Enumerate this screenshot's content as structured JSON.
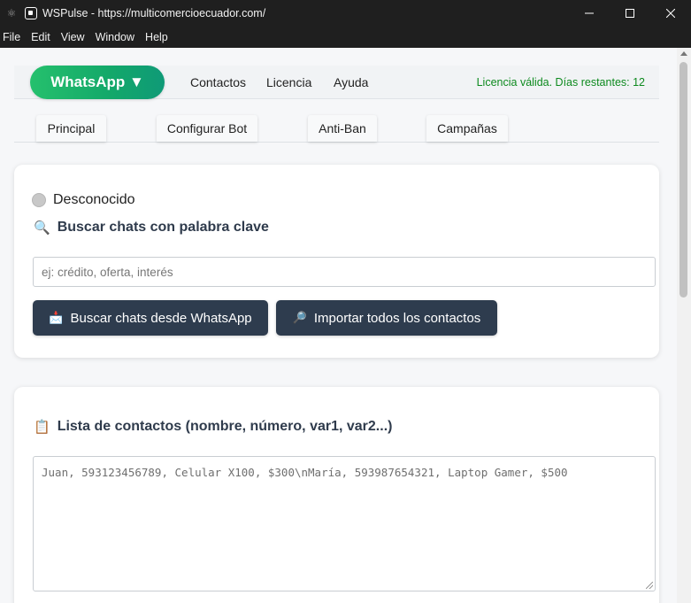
{
  "window": {
    "title": "WSPulse - https://multicomercioecuador.com/",
    "controls": [
      "minimize-icon",
      "maximize-icon",
      "close-icon"
    ]
  },
  "menubar": {
    "items": [
      "File",
      "Edit",
      "View",
      "Window",
      "Help"
    ]
  },
  "navbar": {
    "whatsapp_label": "WhatsApp ▼",
    "links": [
      "Contactos",
      "Licencia",
      "Ayuda"
    ],
    "license_status": "Licencia válida. Días restantes: 12"
  },
  "tabs": [
    "Principal",
    "Configurar Bot",
    "Anti-Ban",
    "Campañas"
  ],
  "connection": {
    "status": "Desconocido"
  },
  "search": {
    "title": "Buscar chats con palabra clave",
    "placeholder": "ej: crédito, oferta, interés",
    "buttons": [
      "Buscar chats desde WhatsApp",
      "Importar todos los contactos"
    ]
  },
  "contacts": {
    "title": "Lista de contactos (nombre, número, var1, var2...)",
    "placeholder": "Juan, 593123456789, Celular X100, $300\\nMaría, 593987654321, Laptop Gamer, $500"
  },
  "colors": {
    "accent_green": "#25c06d",
    "license_green": "#0d8a1e",
    "dark_button": "#2e3c4e"
  }
}
